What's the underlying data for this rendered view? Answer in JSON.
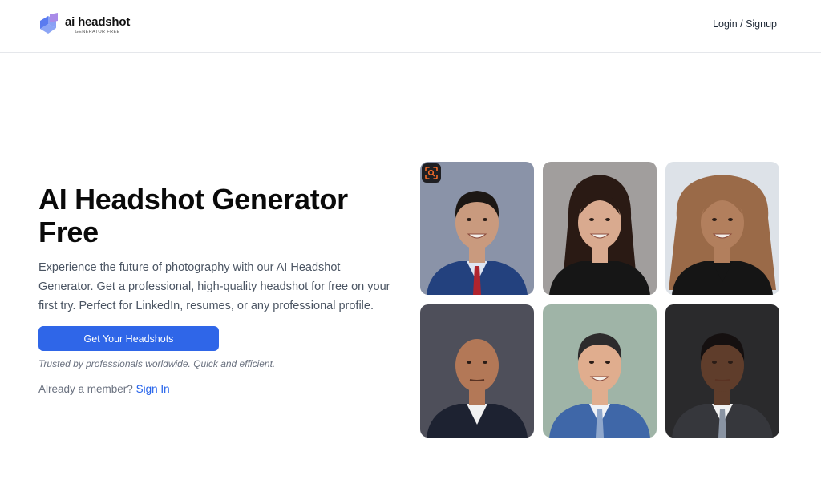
{
  "header": {
    "logo": {
      "title": "ai headshot",
      "subtitle": "GENERATOR FREE"
    },
    "login_label": "Login / Signup"
  },
  "hero": {
    "title_line1": "AI Headshot Generator",
    "title_line2": "Free",
    "description": "Experience the future of photography with our AI Headshot Generator. Get a professional, high-quality headshot for free on your first try. Perfect for LinkedIn, resumes, or any professional profile.",
    "cta_label": "Get Your Headshots",
    "trusted_text": "Trusted by professionals worldwide. Quick and efficient.",
    "member_prompt": "Already a member?",
    "sign_in_label": "Sign In"
  },
  "gallery": {
    "badge_icon": "scan-search-icon",
    "photos": [
      {
        "name": "man-blue-suit-red-tie",
        "bg": "#8a93a8",
        "skin": "#c99a7e",
        "hair": "#1c1714",
        "suit": "#23417e",
        "shirt": "#dfe6f3",
        "tie": "#b0242e"
      },
      {
        "name": "woman-black-blazer",
        "bg": "#a19e9d",
        "skin": "#d9aa8f",
        "hair": "#2a1a14",
        "suit": "#161616",
        "shirt": "#161616",
        "tie": ""
      },
      {
        "name": "woman-wavy-hair",
        "bg": "#dde2e8",
        "skin": "#b27f5d",
        "hair": "#9a6a48",
        "suit": "#151515",
        "shirt": "#151515",
        "tie": ""
      },
      {
        "name": "bald-man-dark-suit",
        "bg": "#4e4f5a",
        "skin": "#b37857",
        "hair": "#b37857",
        "suit": "#1d2231",
        "shirt": "#f1f1f1",
        "tie": ""
      },
      {
        "name": "young-man-blue-blazer",
        "bg": "#9fb4a7",
        "skin": "#e0ad8e",
        "hair": "#2d2b2c",
        "suit": "#3f67a8",
        "shirt": "#f0f2f6",
        "tie": "#8fa7cc"
      },
      {
        "name": "man-grey-suit",
        "bg": "#2a2a2c",
        "skin": "#5f3d2b",
        "hair": "#151010",
        "suit": "#36373c",
        "shirt": "#f2f2f2",
        "tie": "#8a94a3"
      }
    ]
  },
  "colors": {
    "accent": "#2f66e8",
    "link": "#2563eb",
    "badge_orange": "#f26b2a"
  }
}
